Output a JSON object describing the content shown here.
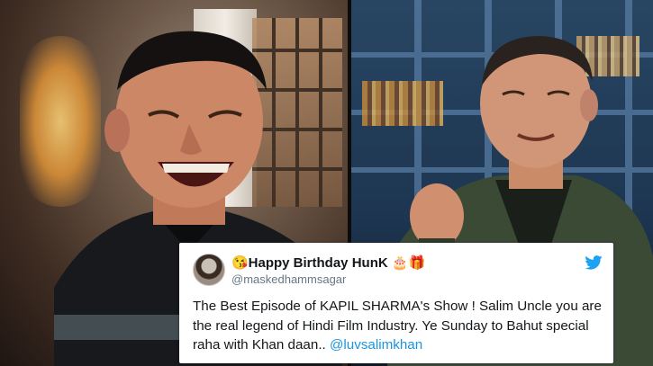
{
  "tweet": {
    "display_name": "😘Happy Birthday HunK 🎂🎁",
    "handle": "@maskedhammsagar",
    "text": "The Best Episode of KAPIL SHARMA's Show ! Salim Uncle you are the real legend of Hindi Film Industry. Ye Sunday to Bahut special raha with Khan daan.. ",
    "mention": "@luvsalimkhan"
  },
  "colors": {
    "link": "#1b95e0",
    "twitter_blue": "#1da1f2",
    "text": "#14171a",
    "muted": "#657786"
  },
  "icons": [
    "twitter-bird-icon",
    "avatar"
  ]
}
